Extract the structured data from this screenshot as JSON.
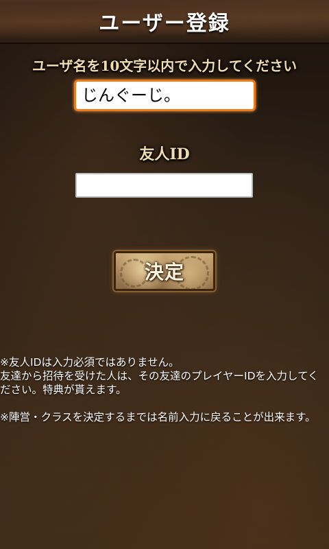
{
  "header": {
    "title": "ユーザー登録"
  },
  "form": {
    "username_label": "ユーザ名を10文字以内で入力してください",
    "username_value": "じんぐーじ。",
    "friend_id_label": "友人ID",
    "friend_id_value": "",
    "confirm_label": "決定"
  },
  "notes": {
    "note1": "※友人IDは入力必須ではありません。",
    "note2": "友達から招待を受けた人は、その友達のプレイヤーIDを入力してください。特典が貰えます。",
    "note3": "※陣営・クラスを決定するまでは名前入力に戻ることが出来ます。"
  },
  "colors": {
    "accent_focus": "#f07a18",
    "label_gold": "#f0dcae"
  }
}
